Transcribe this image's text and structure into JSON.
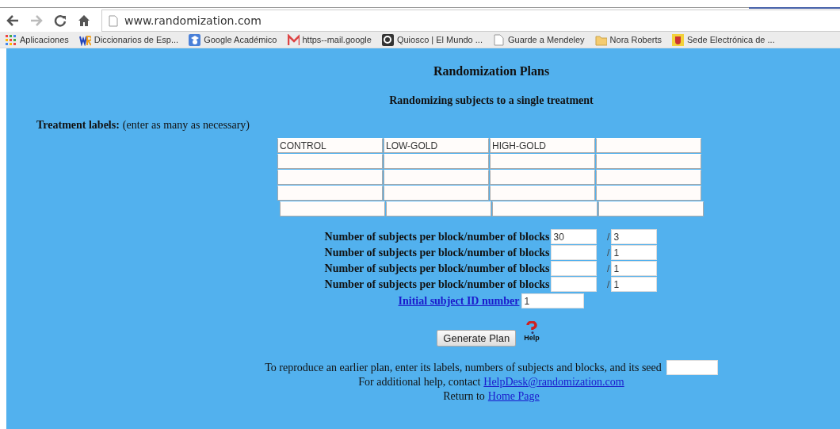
{
  "browser": {
    "url": "www.randomization.com",
    "bookmarks": [
      {
        "kind": "grid",
        "label": "Aplicaciones"
      },
      {
        "kind": "wr",
        "label": "Diccionarios de Esp..."
      },
      {
        "kind": "scholar",
        "label": "Google Académico"
      },
      {
        "kind": "mail",
        "label": "https--mail.google"
      },
      {
        "kind": "square",
        "label": "Quiosco | El Mundo ..."
      },
      {
        "kind": "page",
        "label": "Guarde a Mendeley"
      },
      {
        "kind": "folder",
        "label": "Nora Roberts"
      },
      {
        "kind": "crest",
        "label": "Sede Electrónica de ..."
      }
    ]
  },
  "page": {
    "title": "Randomization Plans",
    "subtitle": "Randomizing subjects to a single treatment",
    "treatment_heading": {
      "label": "Treatment labels:",
      "hint": "(enter as many as necessary)"
    },
    "label_fields": [
      "CONTROL",
      "LOW-GOLD",
      "HIGH-GOLD"
    ],
    "block_rows": [
      {
        "label": "Number of subjects per block/number of blocks",
        "subjects": "30",
        "separator": "/",
        "blocks": "3"
      },
      {
        "label": "Number of subjects per block/number of blocks",
        "separator": "/",
        "blocks": "1"
      },
      {
        "label": "Number of subjects per block/number of blocks",
        "separator": "/",
        "blocks": "1"
      },
      {
        "label": "Number of subjects per block/number of blocks",
        "separator": "/",
        "blocks": "1"
      }
    ],
    "initial_id": {
      "link": "Initial subject ID number",
      "value": "1"
    },
    "generate_button": "Generate Plan",
    "help": "Help",
    "seed_prompt": "To reproduce an earlier plan, enter its labels, numbers of subjects and blocks, and its seed",
    "contact": {
      "text": "For additional help, contact",
      "link": "HelpDesk@randomization.com"
    },
    "return": {
      "text": "Return to",
      "link": "Home Page"
    }
  }
}
